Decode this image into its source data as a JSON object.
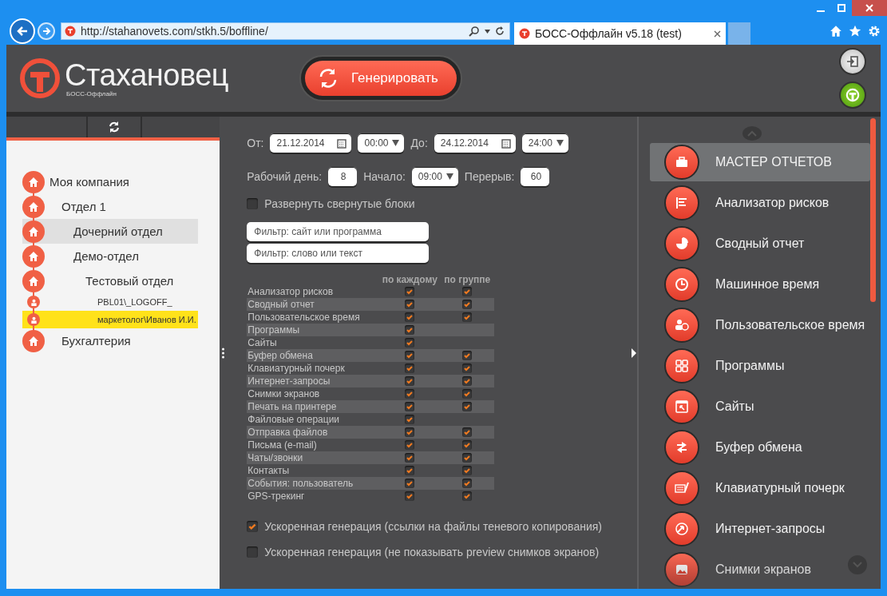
{
  "browser": {
    "url": "http://stahanovets.com/stkh.5/boffline/",
    "tab_title": "БОСС-Оффлайн v5.18 (test)"
  },
  "header": {
    "logo_name": "Стахановец",
    "logo_subtitle": "БОСС-Оффлайн",
    "generate_button": "Генерировать"
  },
  "tree": [
    {
      "label": "Моя компания",
      "kind": "department",
      "selected": false,
      "hovered": false,
      "children": [
        {
          "label": "Отдел 1",
          "kind": "department",
          "selected": false,
          "hovered": false,
          "children": [
            {
              "label": "Дочерний отдел",
              "kind": "department",
              "selected": false,
              "hovered": true
            },
            {
              "label": "Демо-отдел",
              "kind": "department",
              "selected": false,
              "hovered": false,
              "children": [
                {
                  "label": "Тестовый отдел",
                  "kind": "department",
                  "selected": false,
                  "hovered": false,
                  "children": [
                    {
                      "label": "PBL01\\_LOGOFF_",
                      "kind": "user",
                      "selected": false,
                      "hovered": false
                    },
                    {
                      "label": "маркетолог\\Иванов И.И.",
                      "kind": "user",
                      "selected": true,
                      "hovered": false
                    }
                  ]
                }
              ]
            }
          ]
        },
        {
          "label": "Бухгалтерия",
          "kind": "department",
          "selected": false,
          "hovered": false
        }
      ]
    }
  ],
  "period": {
    "from_label": "От:",
    "from_date": "21.12.2014",
    "from_time": "00:00",
    "to_label": "До:",
    "to_date": "24.12.2014",
    "to_time": "24:00"
  },
  "workday": {
    "day_label": "Рабочий день:",
    "day_value": "8",
    "start_label": "Начало:",
    "start_value": "09:00",
    "break_label": "Перерыв:",
    "break_value": "60"
  },
  "expand_blocks": {
    "label": "Развернуть свернутые блоки",
    "checked": false
  },
  "filters": [
    {
      "placeholder": "Фильтр: сайт или программа"
    },
    {
      "placeholder": "Фильтр: слово или текст"
    }
  ],
  "report_table": {
    "columns": [
      "по каждому",
      "по группе"
    ],
    "rows": [
      {
        "label": "Анализатор рисков",
        "per_each": true,
        "per_group": true
      },
      {
        "label": "Сводный отчет",
        "per_each": true,
        "per_group": true
      },
      {
        "label": "Пользовательское время",
        "per_each": true,
        "per_group": true
      },
      {
        "label": "Программы",
        "per_each": true
      },
      {
        "label": "Сайты",
        "per_each": true
      },
      {
        "label": "Буфер обмена",
        "per_each": true,
        "per_group": true
      },
      {
        "label": "Клавиатурный почерк",
        "per_each": true,
        "per_group": true
      },
      {
        "label": "Интернет-запросы",
        "per_each": true,
        "per_group": true
      },
      {
        "label": "Снимки экранов",
        "per_each": true,
        "per_group": true
      },
      {
        "label": "Печать на принтере",
        "per_each": true,
        "per_group": true
      },
      {
        "label": "Файловые операции",
        "per_each": true
      },
      {
        "label": "Отправка файлов",
        "per_each": true,
        "per_group": true
      },
      {
        "label": "Письма (e-mail)",
        "per_each": true,
        "per_group": true
      },
      {
        "label": "Чаты/звонки",
        "per_each": true,
        "per_group": true
      },
      {
        "label": "Контакты",
        "per_each": true,
        "per_group": true
      },
      {
        "label": "События: пользователь",
        "per_each": true,
        "per_group": true
      },
      {
        "label": "GPS-трекинг",
        "per_each": true,
        "per_group": true
      }
    ]
  },
  "options": [
    {
      "label": "Ускоренная генерация (ссылки на файлы теневого копирования)",
      "checked": true
    },
    {
      "label": "Ускоренная генерация (не показывать preview снимков экранов)",
      "checked": false
    }
  ],
  "reports_menu": [
    {
      "label": "МАСТЕР ОТЧЕТОВ",
      "selected": true
    },
    {
      "label": "Анализатор рисков",
      "selected": false
    },
    {
      "label": "Сводный отчет",
      "selected": false
    },
    {
      "label": "Машинное время",
      "selected": false
    },
    {
      "label": "Пользовательское время",
      "selected": false
    },
    {
      "label": "Программы",
      "selected": false
    },
    {
      "label": "Сайты",
      "selected": false
    },
    {
      "label": "Буфер обмена",
      "selected": false
    },
    {
      "label": "Клавиатурный почерк",
      "selected": false
    },
    {
      "label": "Интернет-запросы",
      "selected": false
    },
    {
      "label": "Снимки экранов",
      "selected": false
    }
  ]
}
